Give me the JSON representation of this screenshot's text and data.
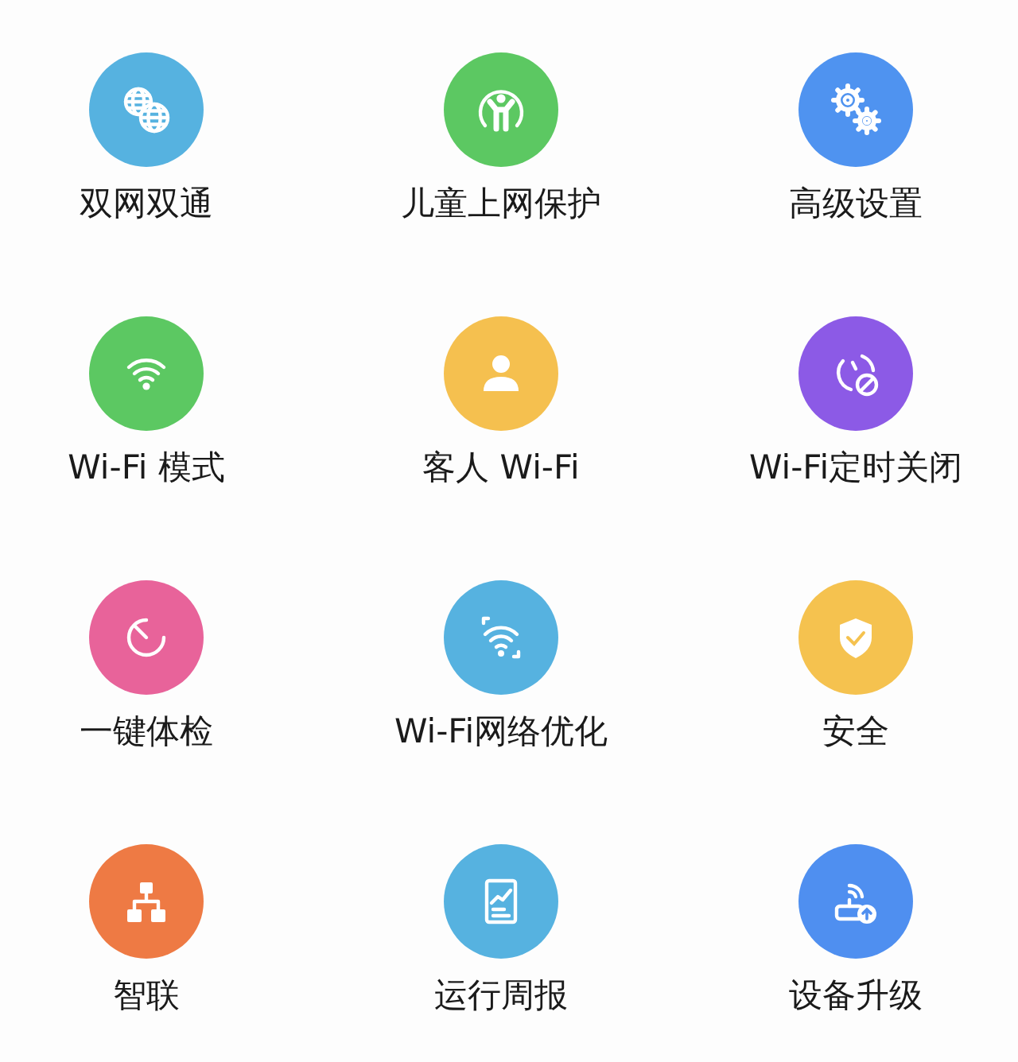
{
  "features": [
    {
      "label": "双网双通",
      "kind": "globes",
      "color": "#56b2e0"
    },
    {
      "label": "儿童上网保护",
      "kind": "child",
      "color": "#5cc862"
    },
    {
      "label": "高级设置",
      "kind": "gears",
      "color": "#4f93f0"
    },
    {
      "label": "Wi-Fi 模式",
      "kind": "wifi",
      "color": "#5cc862"
    },
    {
      "label": "客人 Wi-Fi",
      "kind": "person",
      "color": "#f5c04f"
    },
    {
      "label": "Wi-Fi定时关闭",
      "kind": "timer",
      "color": "#8c5ae6"
    },
    {
      "label": "一键体检",
      "kind": "gauge",
      "color": "#e8639a"
    },
    {
      "label": "Wi-Fi网络优化",
      "kind": "scan",
      "color": "#56b2e0"
    },
    {
      "label": "安全",
      "kind": "shield",
      "color": "#f5c24f"
    },
    {
      "label": "智联",
      "kind": "tree",
      "color": "#ee7a44"
    },
    {
      "label": "运行周报",
      "kind": "report",
      "color": "#56b2e0"
    },
    {
      "label": "设备升级",
      "kind": "upgrade",
      "color": "#4f8ff0"
    }
  ]
}
